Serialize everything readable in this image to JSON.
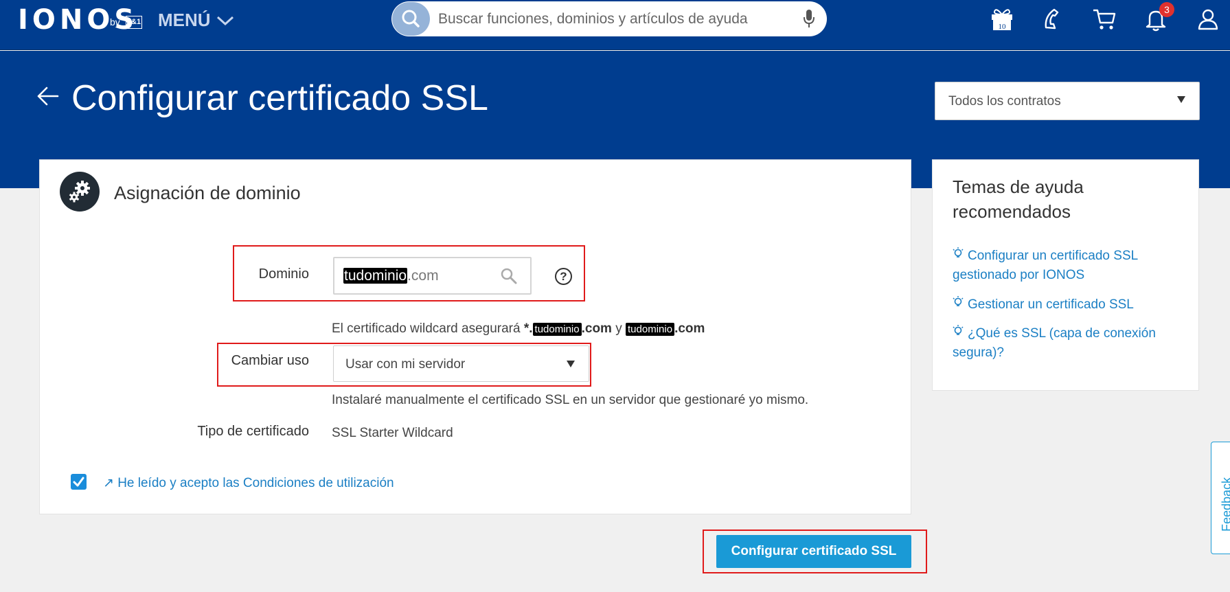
{
  "header": {
    "logo": "IONOS",
    "logo_by": "by",
    "logo_partner": "1&1",
    "menu_label": "MENÚ",
    "search_placeholder": "Buscar funciones, dominios y artículos de ayuda",
    "gift_count": "10",
    "notifications_count": "3"
  },
  "page": {
    "title": "Configurar certificado SSL",
    "contract_filter": "Todos los contratos"
  },
  "main": {
    "section_title": "Asignación de dominio",
    "domain_label": "Dominio",
    "domain_value_masked": "tudominio",
    "domain_value_suffix": ".com",
    "wildcard_prefix": "El certificado wildcard asegurará",
    "wildcard_star": "*.",
    "wildcard_mask_1": "tudominio",
    "wildcard_com_1": ".com",
    "wildcard_and": "y",
    "wildcard_mask_2": "tudominio",
    "wildcard_com_2": ".com",
    "usage_label": "Cambiar uso",
    "usage_value": "Usar con mi servidor",
    "usage_description": "Instalaré manualmente el certificado SSL en un servidor que gestionaré yo mismo.",
    "cert_type_label": "Tipo de certificado",
    "cert_type_value": "SSL Starter Wildcard",
    "terms_checked": true,
    "terms_link": "↗ He leído y acepto las Condiciones de utilización",
    "submit_label": "Configurar certificado SSL"
  },
  "help": {
    "title": "Temas de ayuda recomendados",
    "links": [
      "Configurar un certificado SSL gestionado por IONOS",
      "Gestionar un certificado SSL",
      "¿Qué es SSL (capa de conexión segura)?"
    ]
  },
  "feedback_label": "Feedback",
  "colors": {
    "brand": "#003d8f",
    "accent": "#1a9ad6",
    "link": "#1b7fc4",
    "highlight": "#e01a1a"
  }
}
